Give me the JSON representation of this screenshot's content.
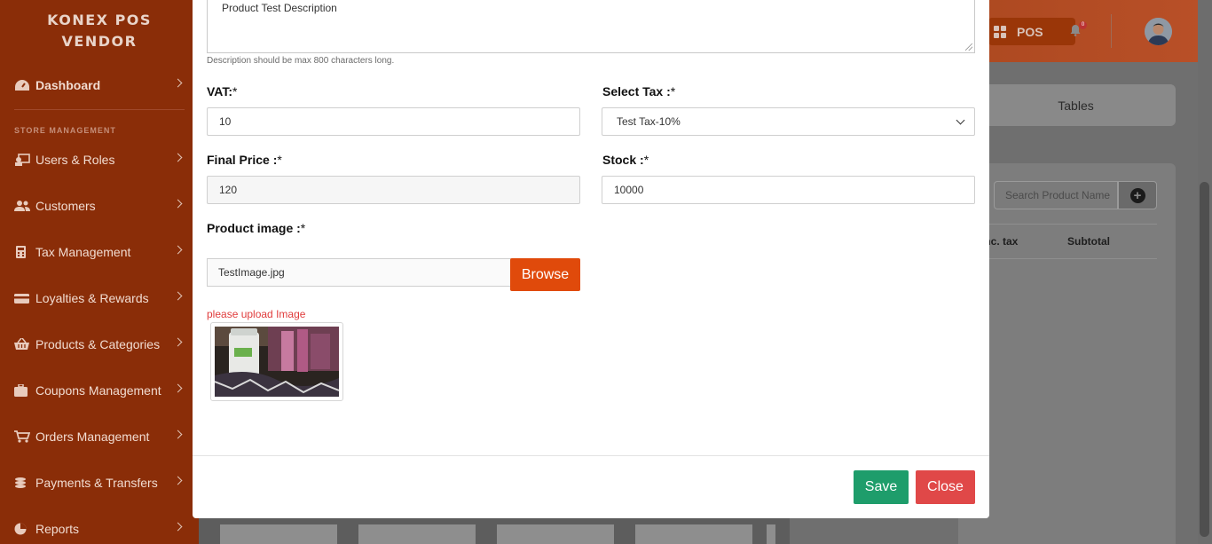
{
  "sidebar": {
    "brand_line1": "KONEX POS",
    "brand_line2": "VENDOR",
    "dashboard": "Dashboard",
    "section_label": "STORE MANAGEMENT",
    "items": [
      {
        "label": "Users & Roles",
        "icon": "users-roles-icon"
      },
      {
        "label": "Customers",
        "icon": "customers-icon"
      },
      {
        "label": "Tax Management",
        "icon": "calculator-icon"
      },
      {
        "label": "Loyalties & Rewards",
        "icon": "credit-card-icon"
      },
      {
        "label": "Products & Categories",
        "icon": "basket-icon"
      },
      {
        "label": "Coupons Management",
        "icon": "briefcase-icon"
      },
      {
        "label": "Orders Management",
        "icon": "cart-icon"
      },
      {
        "label": "Payments & Transfers",
        "icon": "coins-icon"
      },
      {
        "label": "Reports",
        "icon": "pie-chart-icon"
      }
    ]
  },
  "header": {
    "pos_label": "POS",
    "notification_count": "0"
  },
  "background": {
    "tables_tab": "Tables",
    "search_placeholder": "Search Product Name",
    "col_price_inc_tax": "e inc. tax",
    "col_subtotal": "Subtotal"
  },
  "modal": {
    "description_value": "Product Test Description",
    "description_hint": "Description should be max 800 characters long.",
    "vat_label": "VAT:",
    "vat_value": "10",
    "tax_label": "Select Tax :",
    "tax_value": "Test Tax-10%",
    "final_price_label": "Final Price :",
    "final_price_value": "120",
    "stock_label": "Stock :",
    "stock_value": "10000",
    "image_label": "Product image :",
    "required_marker": "*",
    "file_name": "TestImage.jpg",
    "browse_label": "Browse",
    "upload_error": "please upload Image",
    "save_label": "Save",
    "close_label": "Close"
  },
  "colors": {
    "sidebar": "#8a2d08",
    "browse": "#e04a0b",
    "save": "#1e9d6b",
    "close": "#e04848",
    "error": "#e03c3c"
  }
}
